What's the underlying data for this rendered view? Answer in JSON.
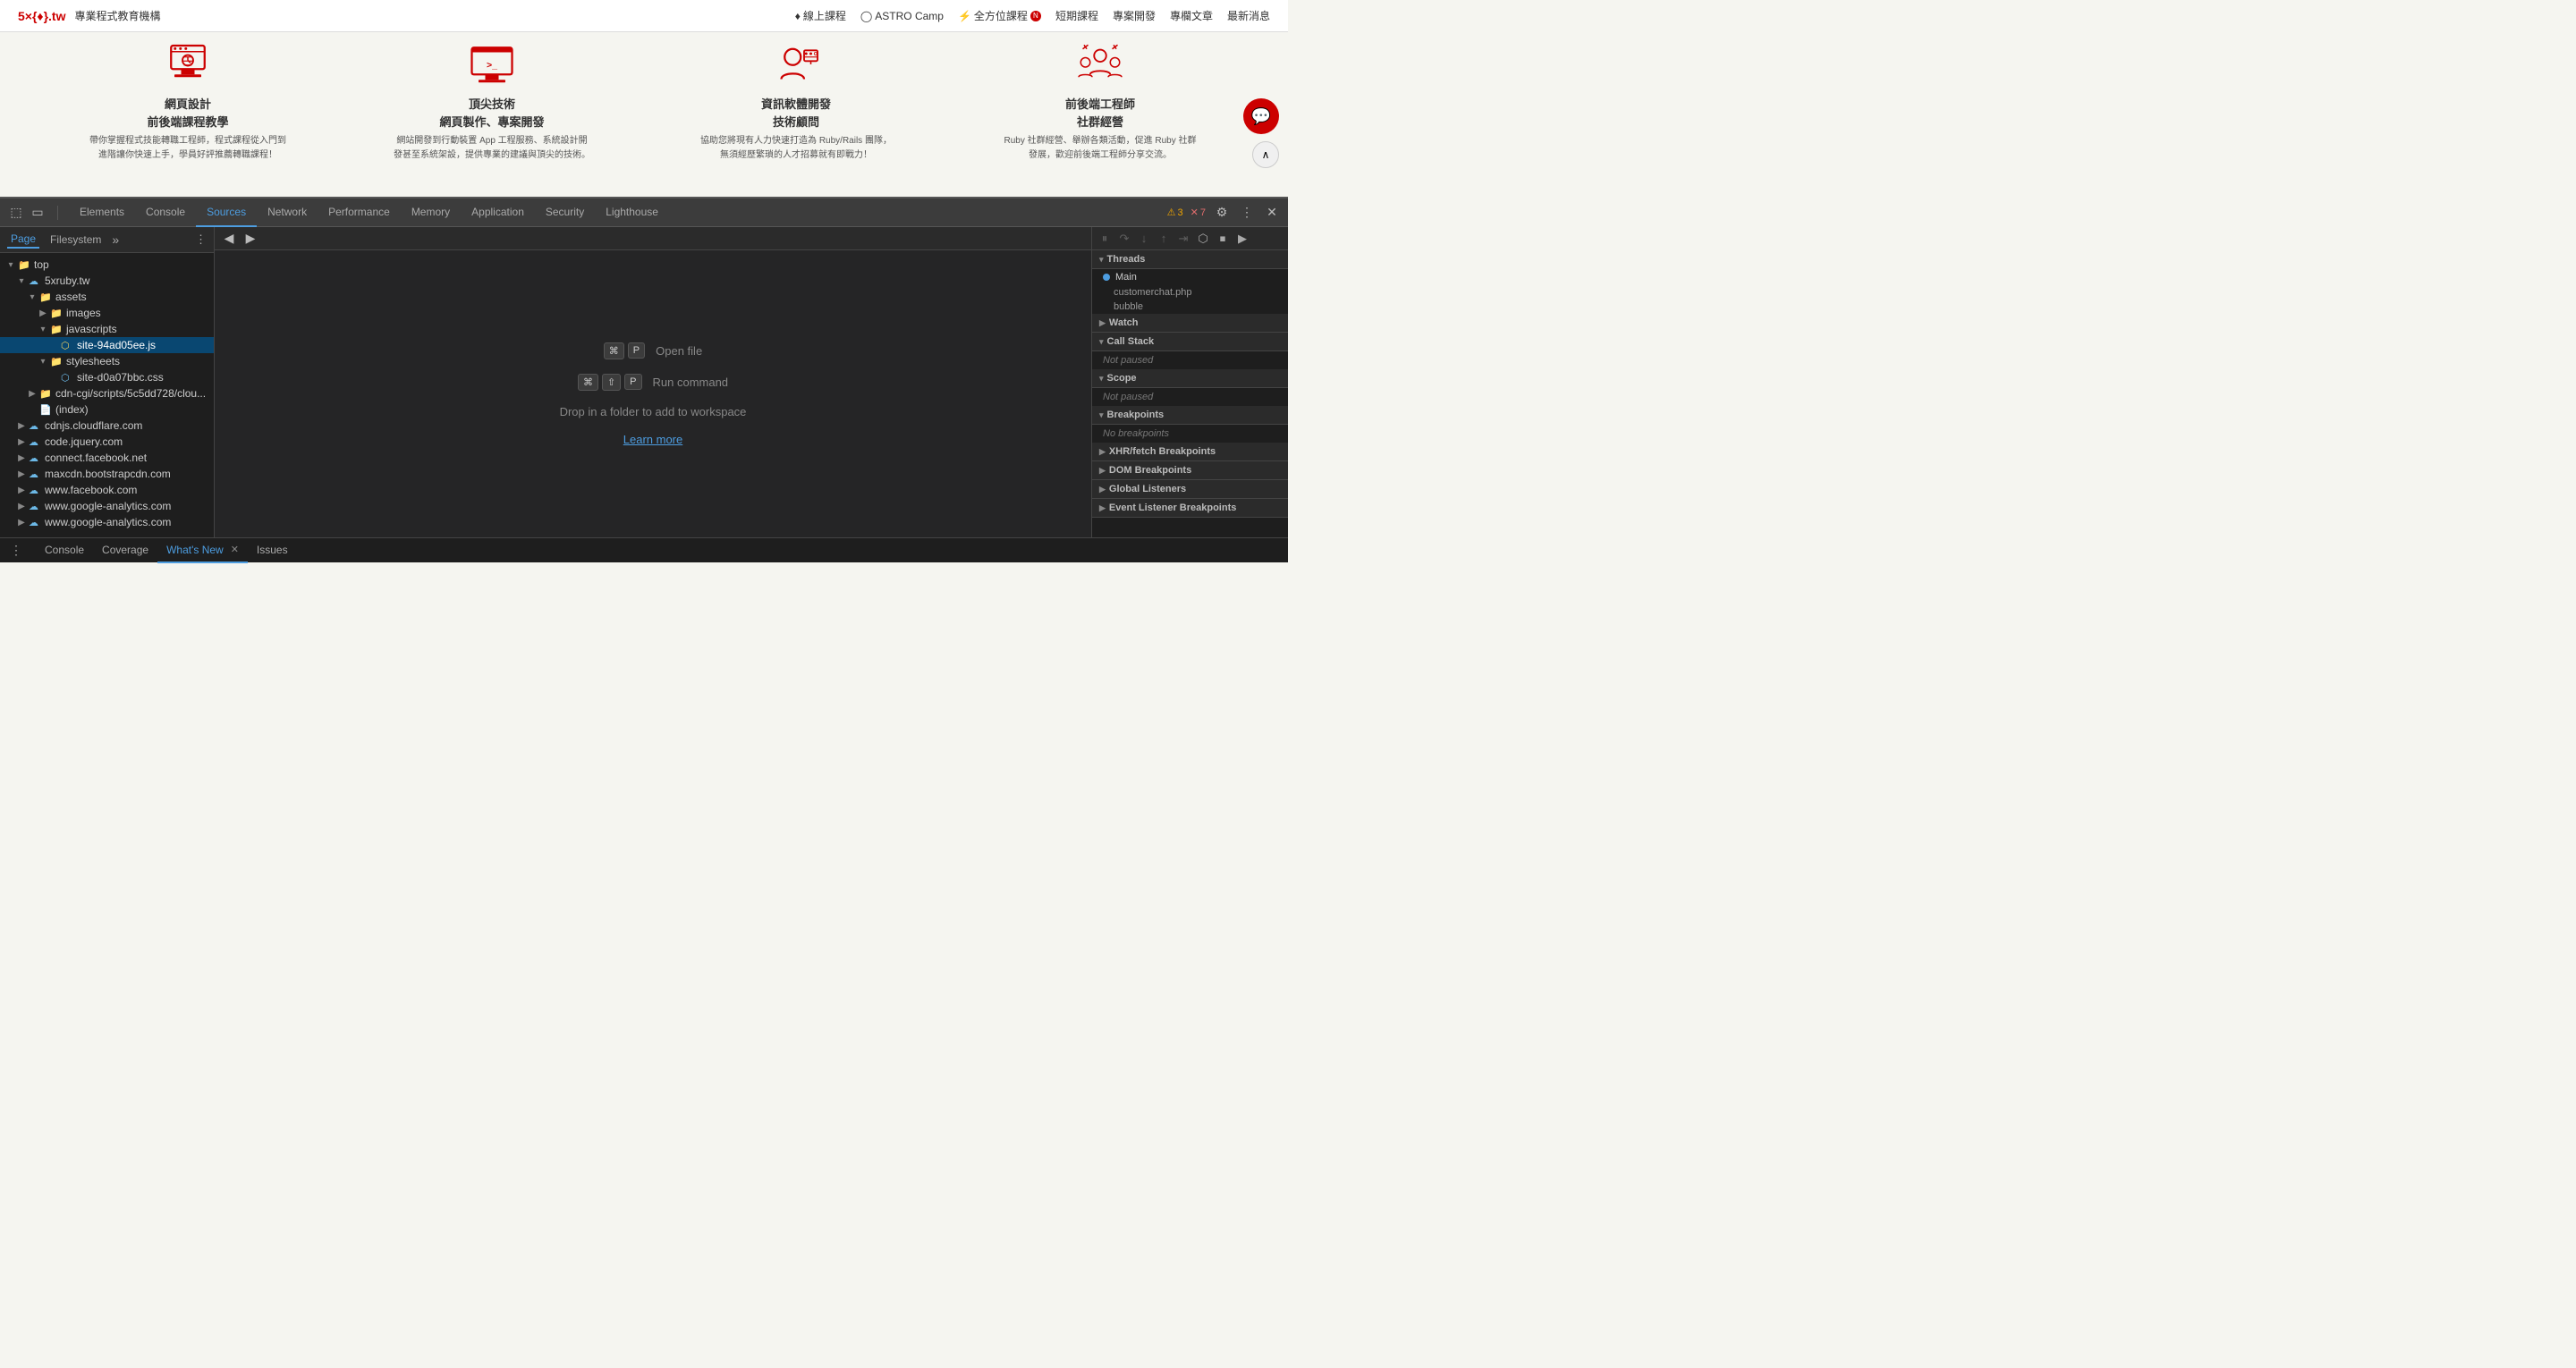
{
  "website": {
    "logo": "5×{♦}.tw",
    "logo_subtitle": "專業程式教育機構",
    "nav_items": [
      {
        "icon": "♦",
        "label": "線上課程"
      },
      {
        "icon": "◯",
        "label": "ASTRO Camp"
      },
      {
        "icon": "⚡",
        "label": "全方位課程",
        "badge": "N"
      },
      {
        "label": "短期課程"
      },
      {
        "label": "專案開發"
      },
      {
        "label": "專欄文章"
      },
      {
        "label": "最新消息"
      }
    ],
    "cards": [
      {
        "id": "web-design",
        "title": "網頁設計\n前後端課程教學",
        "desc": "帶你掌握程式技能轉職工程師，程式課程從入門到進階讓你快速上手，學員好評推薦轉職課程！"
      },
      {
        "id": "top-tech",
        "title": "頂尖技術\n網頁製作、專案開發",
        "desc": "網站開發到行動裝置 App 工程服務、系統設計開發甚至系統架設，提供專業的建議與頂尖的技術。"
      },
      {
        "id": "software-dev",
        "title": "資訊軟體開發\n技術顧問",
        "desc": "協助您將現有人力快速打造為 Ruby/Rails 團隊，無須經歷繁瑣的人才招募就有即戰力！"
      },
      {
        "id": "fullstack-engineer",
        "title": "前後端工程師\n社群經營",
        "desc": "Ruby 社群經營、舉辦各類活動，促進 Ruby 社群發展，歡迎前後端工程師分享交流。"
      }
    ]
  },
  "devtools": {
    "tabs": [
      {
        "label": "Elements",
        "active": false
      },
      {
        "label": "Console",
        "active": false
      },
      {
        "label": "Sources",
        "active": true
      },
      {
        "label": "Network",
        "active": false
      },
      {
        "label": "Performance",
        "active": false
      },
      {
        "label": "Memory",
        "active": false
      },
      {
        "label": "Application",
        "active": false
      },
      {
        "label": "Security",
        "active": false
      },
      {
        "label": "Lighthouse",
        "active": false
      }
    ],
    "warning_count": "3",
    "error_count": "7",
    "file_tree": {
      "tabs": [
        {
          "label": "Page",
          "active": true
        },
        {
          "label": "Filesystem",
          "active": false
        }
      ],
      "items": [
        {
          "id": "top",
          "label": "top",
          "indent": 0,
          "type": "folder",
          "expanded": true
        },
        {
          "id": "5xruby",
          "label": "5xruby.tw",
          "indent": 1,
          "type": "cloud",
          "expanded": true
        },
        {
          "id": "assets",
          "label": "assets",
          "indent": 2,
          "type": "folder",
          "expanded": true
        },
        {
          "id": "images",
          "label": "images",
          "indent": 3,
          "type": "folder",
          "expanded": false
        },
        {
          "id": "javascripts",
          "label": "javascripts",
          "indent": 3,
          "type": "folder",
          "expanded": true
        },
        {
          "id": "site-js",
          "label": "site-94ad05ee.js",
          "indent": 4,
          "type": "js",
          "selected": true
        },
        {
          "id": "stylesheets",
          "label": "stylesheets",
          "indent": 3,
          "type": "folder",
          "expanded": true
        },
        {
          "id": "site-css",
          "label": "site-d0a07bbc.css",
          "indent": 4,
          "type": "css"
        },
        {
          "id": "cdn-cgi",
          "label": "cdn-cgi/scripts/5c5dd728/clou...",
          "indent": 2,
          "type": "folder",
          "expanded": false
        },
        {
          "id": "index",
          "label": "(index)",
          "indent": 2,
          "type": "file"
        },
        {
          "id": "cdnjs",
          "label": "cdnjs.cloudflare.com",
          "indent": 1,
          "type": "cloud",
          "expanded": false
        },
        {
          "id": "codeJquery",
          "label": "code.jquery.com",
          "indent": 1,
          "type": "cloud",
          "expanded": false
        },
        {
          "id": "facebook",
          "label": "connect.facebook.net",
          "indent": 1,
          "type": "cloud",
          "expanded": false
        },
        {
          "id": "bootstrap",
          "label": "maxcdn.bootstrapcdn.com",
          "indent": 1,
          "type": "cloud",
          "expanded": false
        },
        {
          "id": "fbdomain",
          "label": "www.facebook.com",
          "indent": 1,
          "type": "cloud",
          "expanded": false
        },
        {
          "id": "googleanalytics",
          "label": "www.google-analytics.com",
          "indent": 1,
          "type": "cloud",
          "expanded": false
        },
        {
          "id": "googleanalytics2",
          "label": "www.google-analytics.com",
          "indent": 1,
          "type": "cloud",
          "expanded": false
        }
      ]
    },
    "source_area": {
      "shortcut1_keys": [
        "⌘",
        "P"
      ],
      "shortcut1_label": "Open file",
      "shortcut2_keys": [
        "⌘",
        "⇧",
        "P"
      ],
      "shortcut2_label": "Run command",
      "drop_hint": "Drop in a folder to add to workspace",
      "learn_more": "Learn more"
    },
    "right_panel": {
      "debug_buttons": [
        {
          "id": "pause",
          "icon": "⏸",
          "label": "Pause"
        },
        {
          "id": "step-over",
          "icon": "↷",
          "label": "Step over"
        },
        {
          "id": "step-into",
          "icon": "↓",
          "label": "Step into"
        },
        {
          "id": "step-out",
          "icon": "↑",
          "label": "Step out"
        },
        {
          "id": "step-cont",
          "icon": "⇥",
          "label": "Step"
        },
        {
          "id": "deactivate",
          "icon": "⬡",
          "label": "Deactivate breakpoints"
        },
        {
          "id": "abort",
          "icon": "⏹",
          "label": "Stop"
        }
      ],
      "sections": [
        {
          "id": "threads",
          "label": "Threads",
          "expanded": true,
          "content": {
            "threads": [
              {
                "label": "Main",
                "sub_items": [
                  "customerchat.php",
                  "bubble"
                ]
              }
            ]
          }
        },
        {
          "id": "watch",
          "label": "Watch",
          "expanded": false
        },
        {
          "id": "call-stack",
          "label": "Call Stack",
          "expanded": true,
          "content": {
            "status": "Not paused"
          }
        },
        {
          "id": "scope",
          "label": "Scope",
          "expanded": true,
          "content": {
            "status": "Not paused"
          }
        },
        {
          "id": "breakpoints",
          "label": "Breakpoints",
          "expanded": true,
          "content": {
            "status": "No breakpoints"
          }
        },
        {
          "id": "xhr-breakpoints",
          "label": "XHR/fetch Breakpoints",
          "expanded": false
        },
        {
          "id": "dom-breakpoints",
          "label": "DOM Breakpoints",
          "expanded": false
        },
        {
          "id": "global-listeners",
          "label": "Global Listeners",
          "expanded": false
        },
        {
          "id": "event-listener-breakpoints",
          "label": "Event Listener Breakpoints",
          "expanded": false
        }
      ]
    },
    "bottom_tabs": [
      {
        "label": "Console",
        "active": false
      },
      {
        "label": "Coverage",
        "active": false
      },
      {
        "label": "What's New",
        "active": true,
        "closeable": true
      },
      {
        "label": "Issues",
        "active": false
      }
    ]
  }
}
